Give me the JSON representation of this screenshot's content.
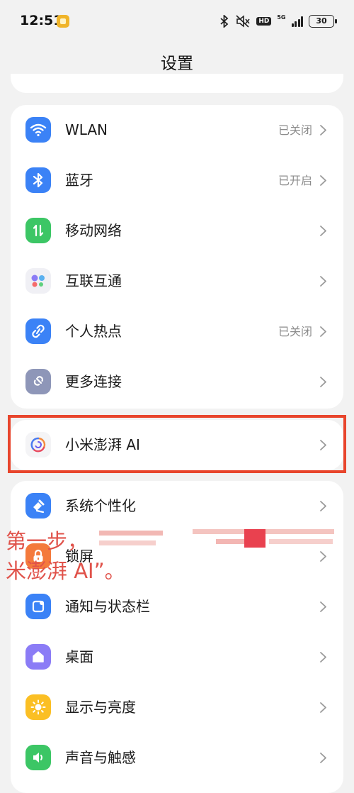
{
  "status_bar": {
    "time": "12:51",
    "network": "5G",
    "hd": "HD",
    "battery": "30"
  },
  "page": {
    "title": "设置"
  },
  "connectivity": [
    {
      "label": "WLAN",
      "value": "已关闭",
      "icon": "wifi-icon"
    },
    {
      "label": "蓝牙",
      "value": "已开启",
      "icon": "bluetooth-icon"
    },
    {
      "label": "移动网络",
      "value": "",
      "icon": "mobile-network-icon"
    },
    {
      "label": "互联互通",
      "value": "",
      "icon": "interconnect-icon"
    },
    {
      "label": "个人热点",
      "value": "已关闭",
      "icon": "hotspot-icon"
    },
    {
      "label": "更多连接",
      "value": "",
      "icon": "link-icon"
    }
  ],
  "ai_item": {
    "label": "小米澎湃 AI",
    "icon": "xiaomi-hyperai-icon"
  },
  "system": [
    {
      "label": "系统个性化",
      "icon": "personalization-icon"
    },
    {
      "label": "锁屏",
      "icon": "lock-icon"
    },
    {
      "label": "通知与状态栏",
      "icon": "notification-icon"
    },
    {
      "label": "桌面",
      "icon": "home-icon"
    },
    {
      "label": "显示与亮度",
      "icon": "brightness-icon"
    },
    {
      "label": "声音与触感",
      "icon": "sound-icon"
    }
  ],
  "annotation": {
    "line1": "第一步，",
    "line2": "米澎湃 AI”。"
  },
  "colors": {
    "wifi": "#3b82f6",
    "bluetooth": "#3b82f6",
    "mobile": "#3cc665",
    "interconnect": "#f0f0f5",
    "hotspot": "#3b82f6",
    "link": "#8e96b8",
    "personalization": "#3b82f6",
    "lock": "#f47a3c",
    "notification": "#3b82f6",
    "home": "#8b7cf6",
    "brightness": "#fbbf24",
    "sound": "#3cc665",
    "highlight": "#e8452c",
    "annotation": "#e0524a"
  }
}
